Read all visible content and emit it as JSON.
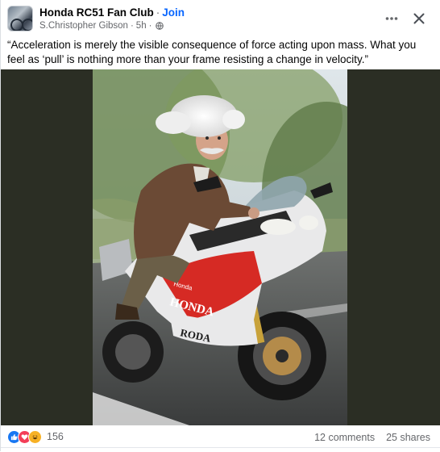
{
  "post": {
    "group_name": "Honda RC51 Fan Club",
    "join_label": "Join",
    "author": "S.Christopher Gibson",
    "time": "5h",
    "separator": "·",
    "caption": "“Acceleration is merely the visible consequence of force acting upon mass. What you feel as ‘pull’ is nothing more than your frame resisting a change in velocity.”",
    "icons": {
      "more": "more-options-icon",
      "close": "close-icon",
      "privacy": "globe-icon"
    }
  },
  "image": {
    "motorcycle_text_1": "HONDA",
    "motorcycle_text_2": "RODA",
    "motorcycle_text_3": "Honda"
  },
  "footer": {
    "reactions": [
      "like",
      "love",
      "haha"
    ],
    "reaction_count": "156",
    "comments": "12 comments",
    "shares": "25 shares"
  },
  "colors": {
    "accent": "#0866ff",
    "like": "#1877f2",
    "love": "#f33e58",
    "haha": "#f7b125",
    "muted_text": "#65676b",
    "media_bg": "#2b2e24"
  }
}
